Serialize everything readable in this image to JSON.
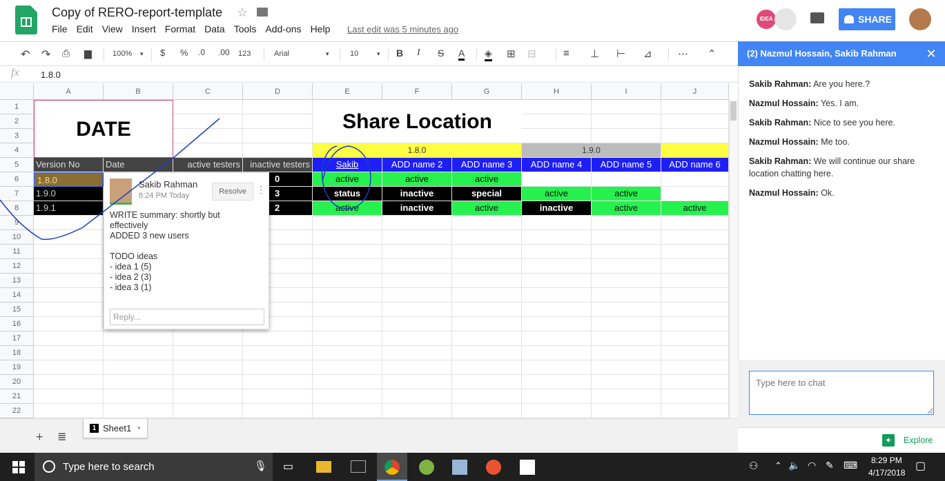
{
  "app": {
    "doc_title": "Copy of RERO-report-template",
    "menu": [
      "File",
      "Edit",
      "View",
      "Insert",
      "Format",
      "Data",
      "Tools",
      "Add-ons",
      "Help"
    ],
    "last_edit": "Last edit was 5 minutes ago",
    "share_label": "SHARE",
    "avatar_text": "IDEA"
  },
  "toolbar": {
    "zoom": "100%",
    "currency": "$",
    "percent": "%",
    "dec_less": ".0",
    "dec_more": ".00",
    "more_formats": "123",
    "font": "Arial",
    "size": "10",
    "bold": "B",
    "italic": "I",
    "strike": "S",
    "text_color": "A"
  },
  "formula": {
    "fx": "fx",
    "value": "1.8.0"
  },
  "columns": [
    "A",
    "B",
    "C",
    "D",
    "E",
    "F",
    "G",
    "H",
    "I",
    "J"
  ],
  "rows": [
    "1",
    "2",
    "3",
    "4",
    "5",
    "6",
    "7",
    "8",
    "9",
    "10",
    "11",
    "12",
    "13",
    "14",
    "15",
    "16",
    "17",
    "18",
    "19",
    "20",
    "21",
    "22"
  ],
  "sheet": {
    "date_title": "DATE",
    "share_title": "Share Location",
    "v180": "1.8.0",
    "v190": "1.9.0",
    "headers": [
      "Version No",
      "Date",
      "active testers",
      "inactive testers",
      "Sakib",
      "ADD name 2",
      "ADD name 3",
      "ADD name 4",
      "ADD name 5",
      "ADD name 6"
    ],
    "row6": [
      "1.8.0",
      "0",
      "active",
      "active",
      "active"
    ],
    "row7": [
      "1.9.0",
      "3",
      "status",
      "inactive",
      "special",
      "active",
      "active"
    ],
    "row8": [
      "1.9.1",
      "2",
      "active",
      "inactive",
      "active",
      "inactive",
      "active",
      "active"
    ]
  },
  "comment": {
    "author": "Sakib Rahman",
    "time": "8:24 PM Today",
    "resolve": "Resolve",
    "lines": [
      "WRITE summary: shortly but",
      "effectively",
      "ADDED 3 new users",
      "",
      "TODO ideas",
      "- idea 1 (5)",
      "- idea 2 (3)",
      "- idea 3 (1)"
    ],
    "reply_placeholder": "Reply..."
  },
  "chat": {
    "header": "(2) Nazmul Hossain, Sakib Rahman",
    "close": "✕",
    "messages": [
      {
        "name": "Sakib Rahman:",
        "text": " Are you here.?"
      },
      {
        "name": "Nazmul Hossain:",
        "text": " Yes. I am."
      },
      {
        "name": "Sakib Rahman:",
        "text": " Nice to see you here."
      },
      {
        "name": "Nazmul Hossain:",
        "text": " Me too."
      },
      {
        "name": "Sakib Rahman:",
        "text": " We will continue our share location chatting here."
      },
      {
        "name": "Nazmul Hossain:",
        "text": " Ok."
      }
    ],
    "placeholder": "Type here to chat"
  },
  "tabs": {
    "sheet1": "Sheet1",
    "sheet_num": "1",
    "plus": "+"
  },
  "explore": "Explore",
  "taskbar": {
    "search": "Type here to search",
    "time": "8:29 PM",
    "date": "4/17/2018"
  }
}
